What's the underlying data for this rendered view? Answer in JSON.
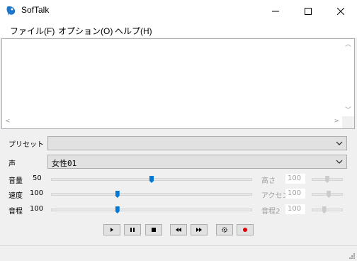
{
  "window": {
    "title": "SofTalk",
    "controls": [
      "minimize",
      "maximize",
      "close"
    ]
  },
  "menu": {
    "items": [
      "ファイル(F)",
      "オプション(O)",
      "ヘルプ(H)"
    ]
  },
  "text_area": {
    "value": ""
  },
  "preset": {
    "label": "プリセット",
    "value": ""
  },
  "voice": {
    "label": "声",
    "value": "女性01"
  },
  "sliders_left": [
    {
      "label": "音量",
      "value": "50",
      "level": 0.5
    },
    {
      "label": "速度",
      "value": "100",
      "level": 0.33
    },
    {
      "label": "音程",
      "value": "100",
      "level": 0.33
    }
  ],
  "sliders_right": [
    {
      "label": "高さ",
      "value": "100",
      "level": 0.5,
      "enabled": false
    },
    {
      "label": "アクセント",
      "value": "100",
      "level": 0.55,
      "enabled": false
    },
    {
      "label": "音程2",
      "value": "100",
      "level": 0.4,
      "enabled": false
    }
  ],
  "playback": {
    "buttons": [
      "play",
      "pause",
      "stop",
      "rewind",
      "fast-forward",
      "settings",
      "record"
    ]
  },
  "colors": {
    "accent": "#0078d7",
    "record": "#e00000"
  }
}
